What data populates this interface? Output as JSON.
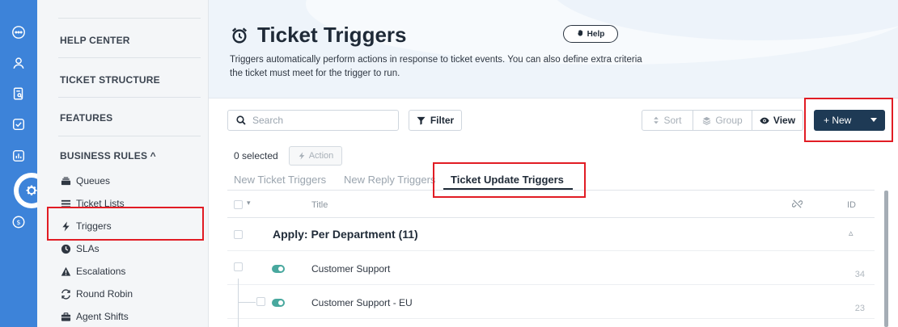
{
  "rail": {
    "icons": [
      "chat-icon",
      "user-icon",
      "knowledge-icon",
      "tasks-icon",
      "reports-icon",
      "admin-gear-icon",
      "billing-icon"
    ]
  },
  "sidebar": {
    "sections": {
      "help_center": "HELP CENTER",
      "ticket_structure": "TICKET STRUCTURE",
      "features": "FEATURES",
      "business_rules": "BUSINESS RULES ^"
    },
    "items": [
      {
        "label": "Queues",
        "icon": "stack-icon"
      },
      {
        "label": "Ticket Lists",
        "icon": "list-icon"
      },
      {
        "label": "Triggers",
        "icon": "bolt-icon"
      },
      {
        "label": "SLAs",
        "icon": "clock-icon"
      },
      {
        "label": "Escalations",
        "icon": "warning-icon"
      },
      {
        "label": "Round Robin",
        "icon": "rotate-icon"
      },
      {
        "label": "Agent Shifts",
        "icon": "briefcase-icon"
      }
    ]
  },
  "header": {
    "title": "Ticket Triggers",
    "help_label": "Help",
    "description": "Triggers automatically perform actions in response to ticket events. You can also define extra criteria the ticket must meet for the trigger to run."
  },
  "toolbar": {
    "search_placeholder": "Search",
    "filter_label": "Filter",
    "sort_label": "Sort",
    "group_label": "Group",
    "view_label": "View",
    "new_label": "+ New"
  },
  "selection": {
    "count_label": "0 selected",
    "action_label": "Action"
  },
  "tabs": [
    {
      "label": "New Ticket Triggers",
      "active": false
    },
    {
      "label": "New Reply Triggers",
      "active": false
    },
    {
      "label": "Ticket Update Triggers",
      "active": true
    }
  ],
  "table": {
    "columns": {
      "title": "Title",
      "id": "ID"
    },
    "group": {
      "label": "Apply: Per Department (11)"
    },
    "rows": [
      {
        "title": "Customer Support",
        "id": "34",
        "enabled": true
      },
      {
        "title": "Customer Support - EU",
        "id": "23",
        "enabled": true
      }
    ]
  },
  "colors": {
    "rail": "#3d83d9",
    "primary_button": "#1e3a55",
    "toggle_on": "#48a89e",
    "highlight": "#e11c24"
  }
}
